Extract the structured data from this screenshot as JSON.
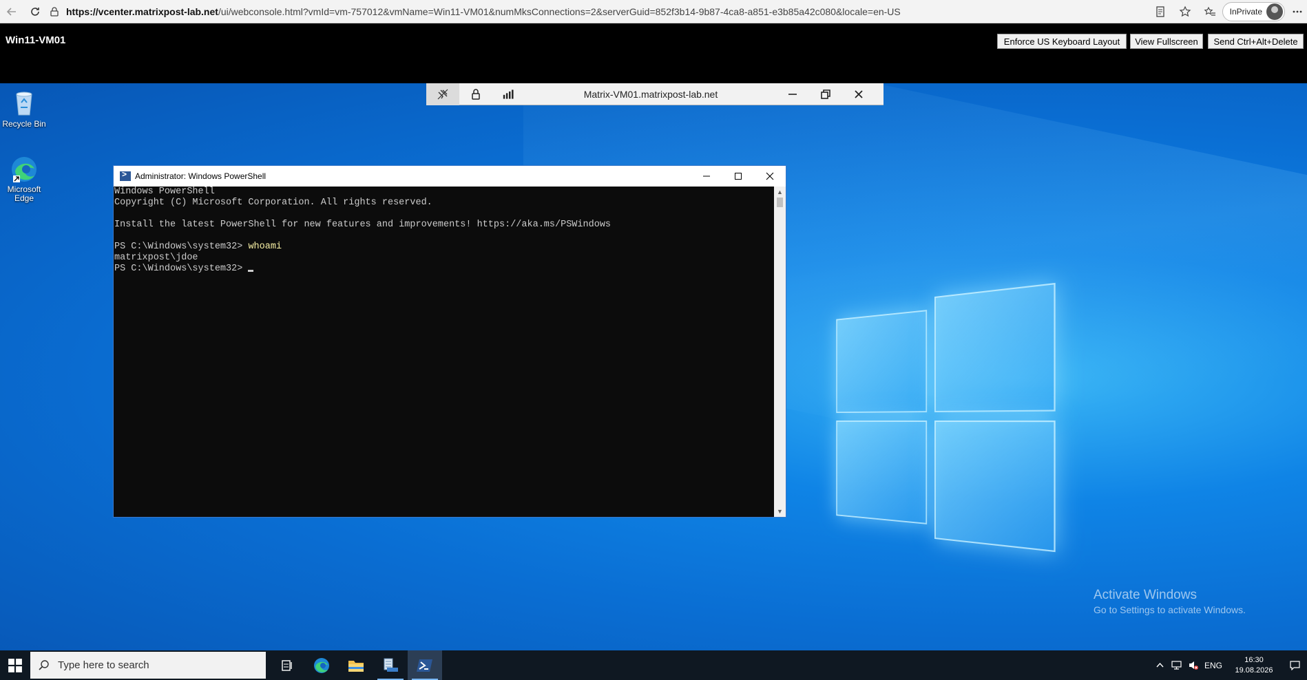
{
  "browser": {
    "url_host": "https://vcenter.matrixpost-lab.net",
    "url_rest": "/ui/webconsole.html?vmId=vm-757012&vmName=Win11-VM01&numMksConnections=2&serverGuid=852f3b14-9b87-4ca8-a851-e3b85a42c080&locale=en-US",
    "inprivate_label": "InPrivate"
  },
  "console": {
    "vm_name": "Win11-VM01",
    "buttons": {
      "keyboard": "Enforce US Keyboard Layout",
      "fullscreen": "View Fullscreen",
      "cad": "Send Ctrl+Alt+Delete"
    }
  },
  "remote_toolbar": {
    "title": "Matrix-VM01.matrixpost-lab.net"
  },
  "desktop_icons": {
    "recycle": "Recycle Bin",
    "edge": "Microsoft Edge"
  },
  "powershell": {
    "title": "Administrator: Windows PowerShell",
    "lines": [
      "Windows PowerShell",
      "Copyright (C) Microsoft Corporation. All rights reserved.",
      "",
      "Install the latest PowerShell for new features and improvements! https://aka.ms/PSWindows",
      "",
      "PS C:\\Windows\\system32> ",
      "matrixpost\\jdoe",
      "PS C:\\Windows\\system32> "
    ],
    "command": "whoami"
  },
  "watermark": {
    "line1": "Activate Windows",
    "line2": "Go to Settings to activate Windows."
  },
  "taskbar": {
    "search_placeholder": "Type here to search",
    "language": "ENG",
    "time": "16:30",
    "date": "19.08.2026"
  }
}
